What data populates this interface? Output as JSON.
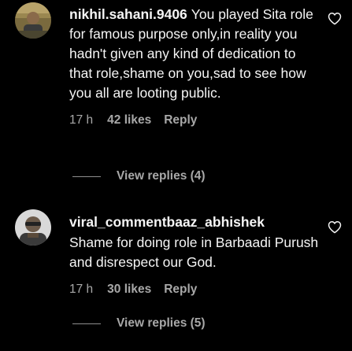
{
  "comments": [
    {
      "username": "nikhil.sahani.9406",
      "text": "You played Sita role for famous purpose only,in reality you hadn't given any kind of dedication to that role,shame on you,sad to see how you all are looting public.",
      "time": "17 h",
      "likes": "42 likes",
      "reply_label": "Reply",
      "view_replies_label": "View replies (4)"
    },
    {
      "username": "viral_commentbaaz_abhishek",
      "text": "Shame for doing role in Barbaadi Purush and disrespect our God.",
      "time": "17 h",
      "likes": "30 likes",
      "reply_label": "Reply",
      "view_replies_label": "View replies (5)"
    }
  ],
  "colors": {
    "background": "#000000",
    "text": "#f5f5f5",
    "secondary": "#a8a8a8"
  },
  "icons": [
    "heart-outline-icon",
    "avatar-photo"
  ]
}
